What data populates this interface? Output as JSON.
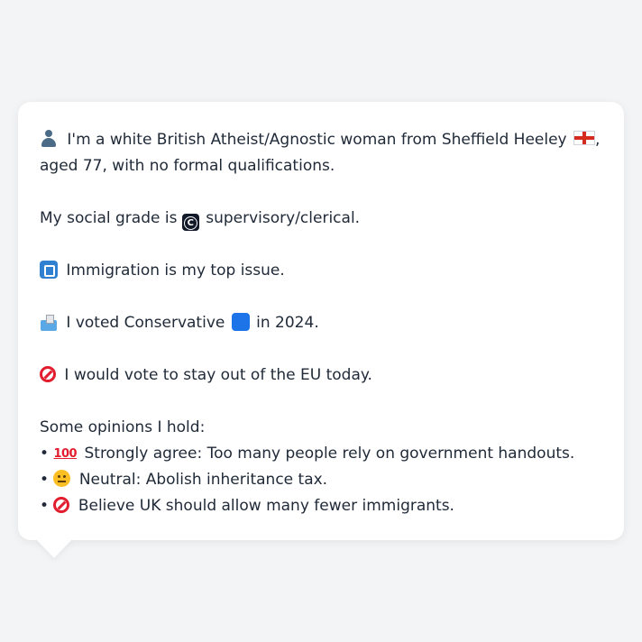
{
  "profile": {
    "line1_text": " I'm a white British Atheist/Agnostic woman from Sheffield Heeley ",
    "line1_end": ",",
    "line2_text": "aged 77, with no formal qualifications.",
    "social_grade_prefix": "My social grade is ",
    "social_grade_letter": "C",
    "social_grade_suffix": " supervisory/clerical.",
    "top_issue_text": " Immigration is my top issue.",
    "vote_prefix": " I voted Conservative ",
    "vote_suffix": " in 2024.",
    "eu_text": " I would vote to stay out of the EU today.",
    "opinions_heading": "Some opinions I hold:",
    "opinions": [
      {
        "bullet": "• ",
        "icon": "hundred-points-icon",
        "icon_text": "100",
        "text": " Strongly agree: Too many people rely on government handouts."
      },
      {
        "bullet": "• ",
        "icon": "neutral-face-icon",
        "text": " Neutral: Abolish inheritance tax."
      },
      {
        "bullet": "• ",
        "icon": "no-entry-icon",
        "text": " Believe UK should allow many fewer immigrants."
      }
    ]
  },
  "colors": {
    "background": "#f3f4f6",
    "card": "#ffffff",
    "text": "#1f2937",
    "conservative_blue": "#1d73e8",
    "no_entry_red": "#e11d2e"
  }
}
